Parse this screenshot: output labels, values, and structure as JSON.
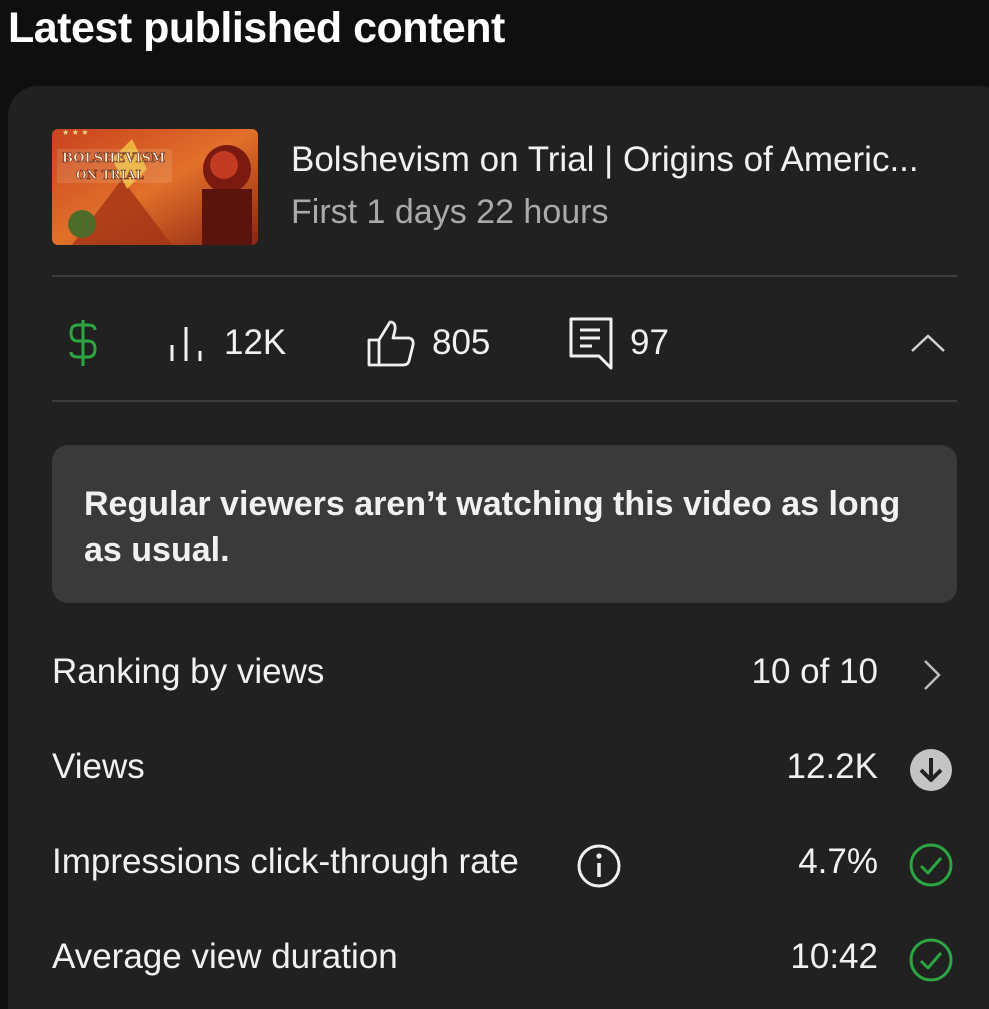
{
  "section": {
    "title": "Latest published content"
  },
  "video": {
    "title": "Bolshevism on Trial | Origins of Americ...",
    "subtitle": "First 1 days 22 hours",
    "thumbnail_text_line1": "BOLSHEVISM",
    "thumbnail_text_line2": "ON TRIAL"
  },
  "stats": {
    "revenue_icon": "dollar-icon",
    "views": "12K",
    "likes": "805",
    "comments": "97"
  },
  "insight": {
    "text": "Regular viewers aren’t watching this video as long as usual."
  },
  "metrics": [
    {
      "label": "Ranking by views",
      "value": "10 of 10",
      "icon": "chevron-right-icon"
    },
    {
      "label": "Views",
      "value": "12.2K",
      "icon": "arrow-down-circle-icon"
    },
    {
      "label": "Impressions click-through rate",
      "value": "4.7%",
      "icon": "check-circle-icon"
    },
    {
      "label": "Average view duration",
      "value": "10:42",
      "icon": "check-circle-icon"
    }
  ],
  "colors": {
    "background": "#0f0f0f",
    "card": "#212121",
    "insight_bg": "#3a3a3a",
    "accent_green": "#2ba640",
    "muted_text": "#aaaaaa"
  }
}
